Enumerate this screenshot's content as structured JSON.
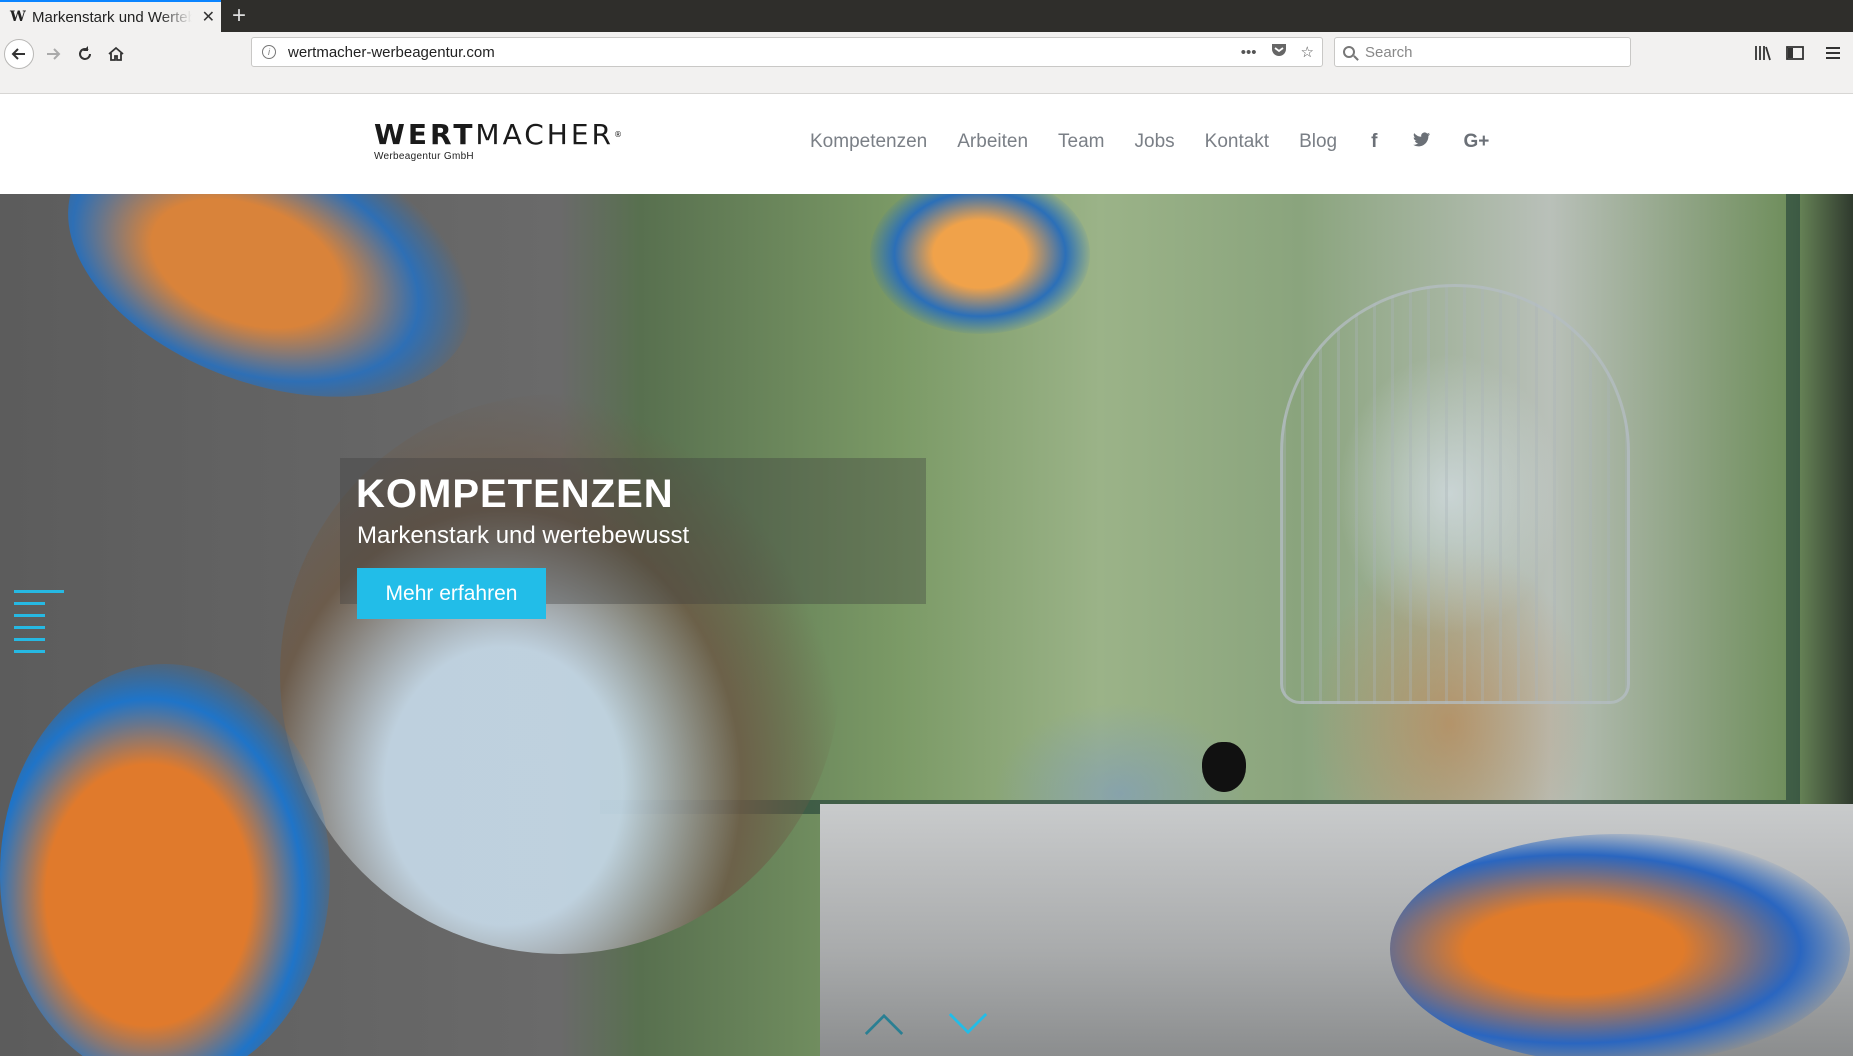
{
  "browser": {
    "tab_title": "Markenstark und Wertebewusst",
    "tab_favicon": "W",
    "url": "wertmacher-werbeagentur.com",
    "search_placeholder": "Search"
  },
  "site": {
    "logo": {
      "bold": "WERT",
      "rest": "MACHER",
      "registered": "®",
      "tagline": "Werbeagentur GmbH"
    },
    "nav": [
      "Kompetenzen",
      "Arbeiten",
      "Team",
      "Jobs",
      "Kontakt",
      "Blog"
    ],
    "social": {
      "facebook": "f",
      "twitter": "t",
      "google": "G+"
    }
  },
  "hero": {
    "title": "KOMPETENZEN",
    "subtitle": "Markenstark und wertebewusst",
    "cta": "Mehr erfahren"
  },
  "colors": {
    "accent": "#22bde8",
    "nav_text": "#7a7f86",
    "tab_highlight": "#0a84ff"
  }
}
